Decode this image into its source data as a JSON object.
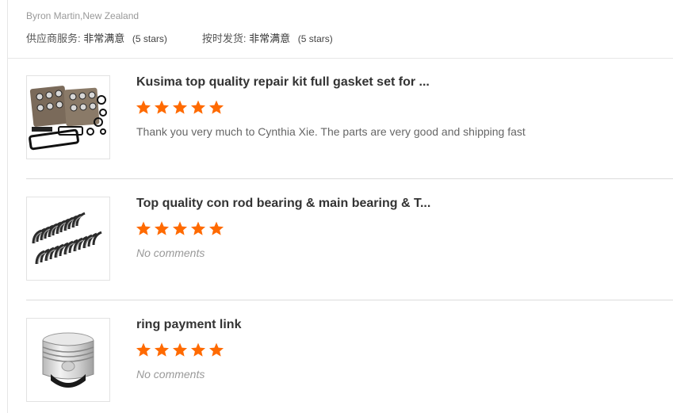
{
  "reviewer": "Byron Martin,New Zealand",
  "ratings": [
    {
      "label": "供应商服务:",
      "value": "非常满意",
      "stars": "(5 stars)"
    },
    {
      "label": "按时发货:",
      "value": "非常满意",
      "stars": "(5 stars)"
    }
  ],
  "star_color": "#ff6a00",
  "reviews": [
    {
      "title": "Kusima top quality repair kit full gasket set for ...",
      "rating": 5,
      "comment": "Thank you very much to Cynthia Xie. The parts are very good and shipping fast",
      "thumbnail_icon": "gasket-set-icon"
    },
    {
      "title": "Top quality con rod bearing & main bearing & T...",
      "rating": 5,
      "comment": "No comments",
      "thumbnail_icon": "bearing-set-icon"
    },
    {
      "title": "ring payment link",
      "rating": 5,
      "comment": "No comments",
      "thumbnail_icon": "piston-icon"
    }
  ]
}
